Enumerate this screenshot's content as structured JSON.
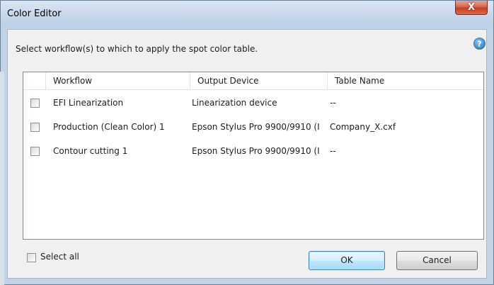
{
  "window": {
    "title": "Color Editor",
    "close_symbol": "X"
  },
  "instruction": "Select workflow(s) to which to apply the spot color table.",
  "help_icon": "help-icon",
  "table": {
    "columns": [
      "Workflow",
      "Output Device",
      "Table Name"
    ],
    "rows": [
      {
        "checked": false,
        "workflow": "EFI Linearization",
        "output_device": "Linearization device",
        "table_name": "--"
      },
      {
        "checked": false,
        "workflow": "Production (Clean Color) 1",
        "output_device": "Epson Stylus Pro 9900/9910 (I",
        "table_name": "Company_X.cxf"
      },
      {
        "checked": false,
        "workflow": "Contour cutting 1",
        "output_device": "Epson Stylus Pro 9900/9910 (I",
        "table_name": "--"
      }
    ]
  },
  "select_all": {
    "label": "Select all",
    "checked": false
  },
  "buttons": {
    "ok": "OK",
    "cancel": "Cancel"
  },
  "colors": {
    "accent": "#3c7fb1",
    "titlebar": "#c5d6ea",
    "close_button": "#c13f26",
    "help_icon": "#2f7ccf"
  }
}
